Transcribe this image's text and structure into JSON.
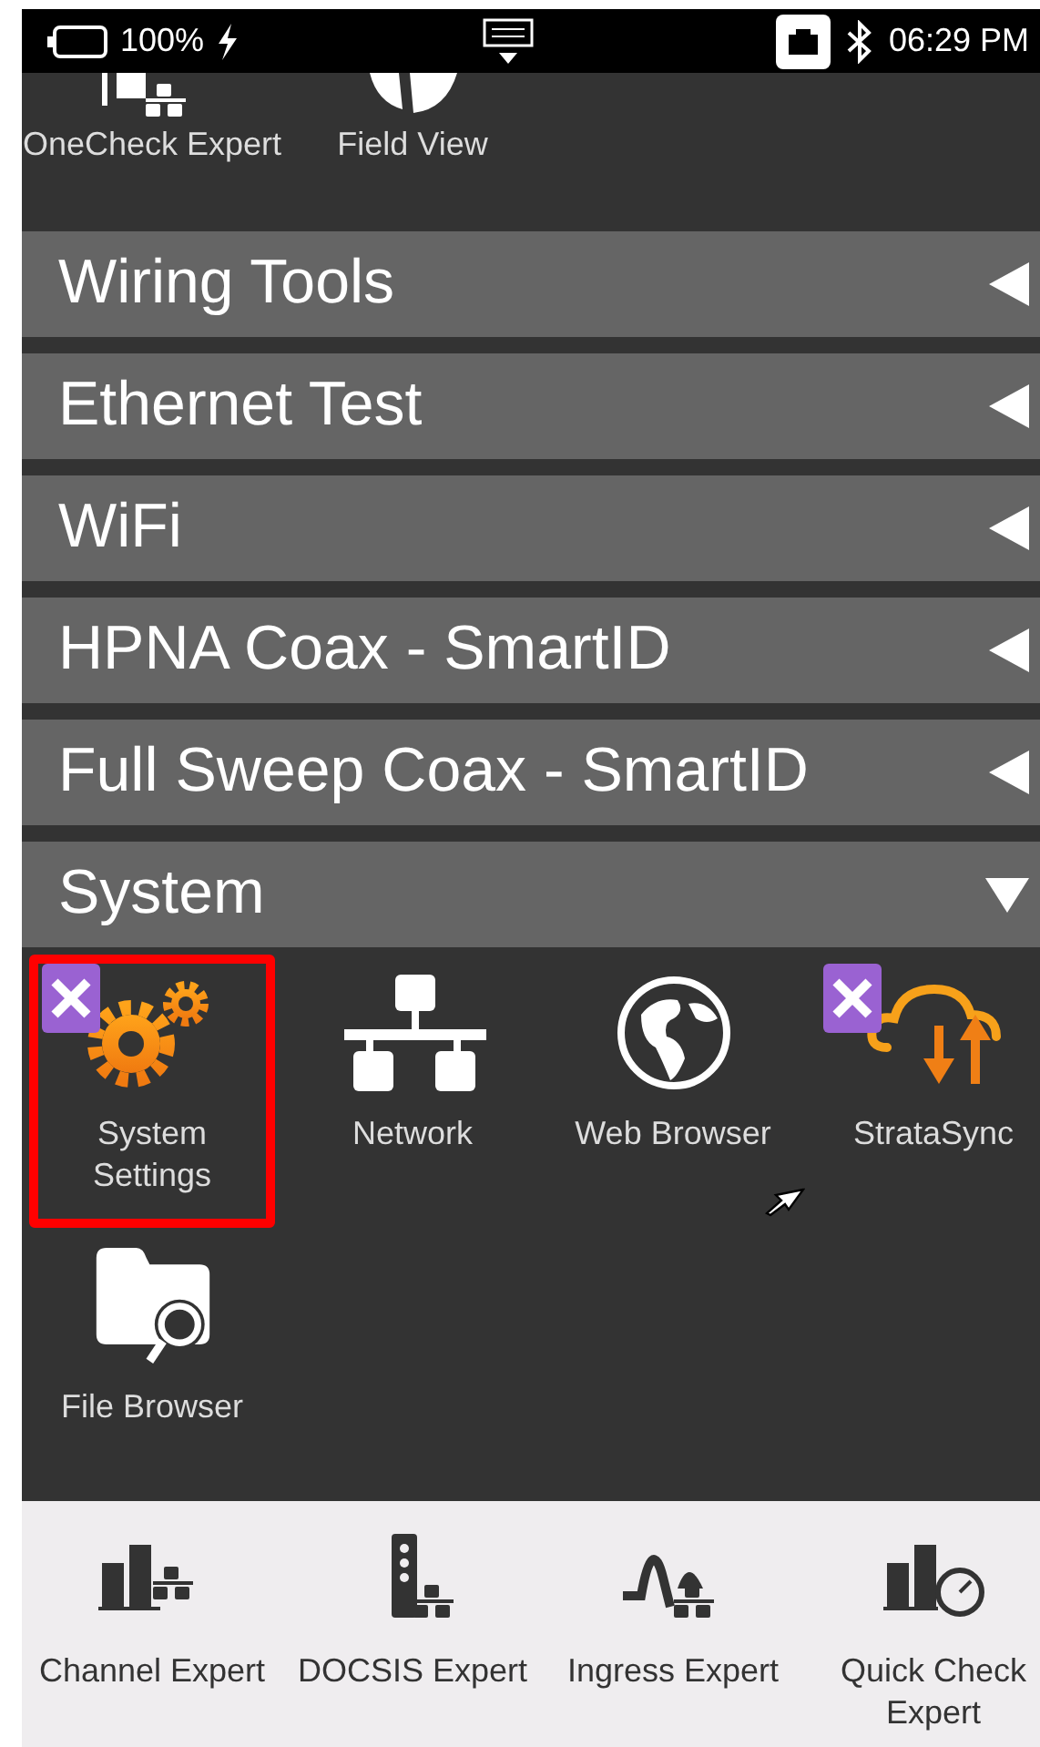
{
  "status_bar": {
    "battery": "100%",
    "time": "06:29 PM"
  },
  "top_apps": [
    {
      "label": "OneCheck Expert",
      "kind": "onecheck"
    },
    {
      "label": "Field View",
      "kind": "fieldview"
    }
  ],
  "sections": [
    {
      "label": "Wiring Tools",
      "expanded": false
    },
    {
      "label": "Ethernet Test",
      "expanded": false
    },
    {
      "label": "WiFi",
      "expanded": false
    },
    {
      "label": "HPNA Coax - SmartID",
      "expanded": false
    },
    {
      "label": "Full Sweep Coax - SmartID",
      "expanded": false
    },
    {
      "label": "System",
      "expanded": true
    }
  ],
  "system_apps": [
    {
      "label": "System Settings",
      "kind": "gears",
      "selected": true,
      "removable": true
    },
    {
      "label": "Network",
      "kind": "network",
      "selected": false,
      "removable": false
    },
    {
      "label": "Web Browser",
      "kind": "globe",
      "selected": false,
      "removable": false
    },
    {
      "label": "StrataSync",
      "kind": "cloud",
      "selected": false,
      "removable": true
    },
    {
      "label": "File Browser",
      "kind": "folder",
      "selected": false,
      "removable": false
    }
  ],
  "dock": [
    {
      "label": "Channel Expert",
      "kind": "channel"
    },
    {
      "label": "DOCSIS Expert",
      "kind": "docsis"
    },
    {
      "label": "Ingress Expert",
      "kind": "ingress"
    },
    {
      "label": "Quick Check Expert",
      "kind": "quickcheck"
    }
  ]
}
